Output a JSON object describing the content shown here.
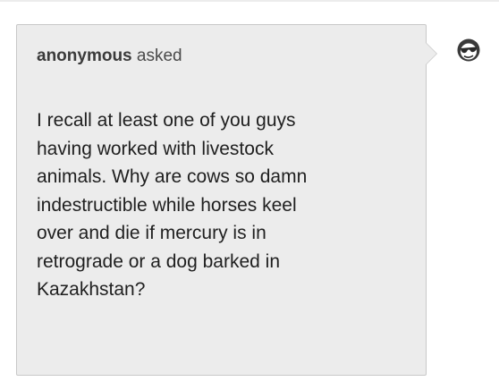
{
  "ask": {
    "asker_name": "anonymous",
    "asker_verb": "asked",
    "question": "I recall at least one of you guys\nhaving worked with livestock\nanimals. Why are cows so damn\nindestructible while horses keel\nover and die if mercury is in\nretrograde or a dog barked in\nKazakhstan?"
  },
  "avatar": {
    "icon": "anonymous-sunglasses-icon"
  },
  "colors": {
    "bubble_background": "#ececec",
    "bubble_border": "#c8c8c8",
    "text": "#1f1f1f"
  }
}
